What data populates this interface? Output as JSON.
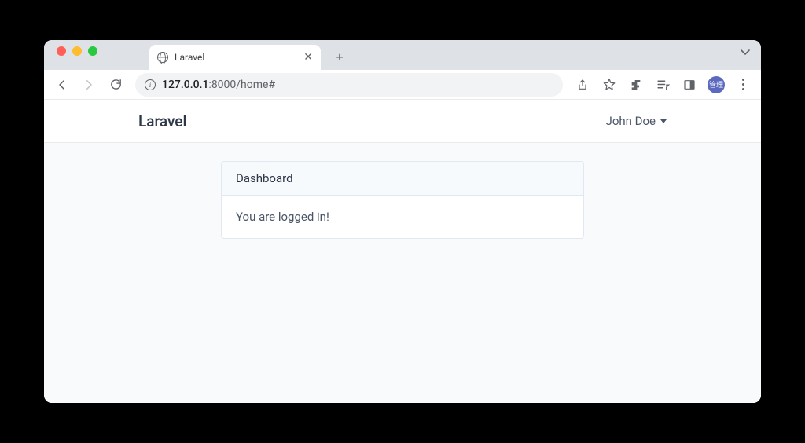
{
  "browser": {
    "tab_title": "Laravel",
    "url_host": "127.0.0.1",
    "url_port_path": ":8000/home#",
    "avatar_text": "管理"
  },
  "navbar": {
    "brand": "Laravel",
    "user_name": "John Doe"
  },
  "card": {
    "header": "Dashboard",
    "body": "You are logged in!"
  }
}
